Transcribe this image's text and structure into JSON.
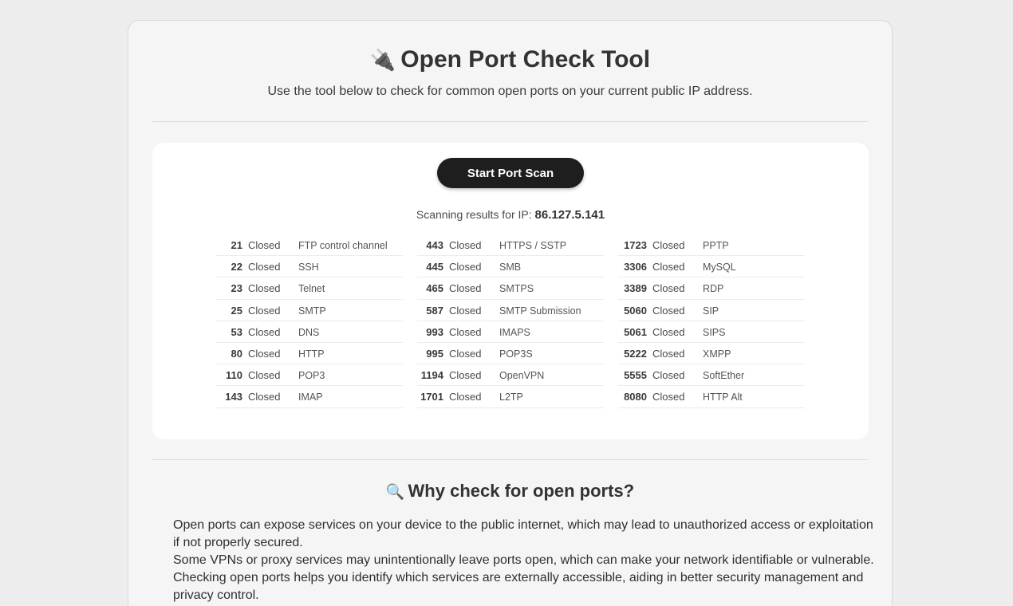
{
  "header": {
    "title_icon": "🔌",
    "title": "Open Port Check Tool",
    "subtitle": "Use the tool below to check for common open ports on your current public IP address."
  },
  "scan": {
    "button_label": "Start Port Scan",
    "results_label": "Scanning results for IP:",
    "ip": "86.127.5.141"
  },
  "ports": {
    "columns": [
      [
        {
          "port": "21",
          "status": "Closed",
          "service": "FTP control channel"
        },
        {
          "port": "22",
          "status": "Closed",
          "service": "SSH"
        },
        {
          "port": "23",
          "status": "Closed",
          "service": "Telnet"
        },
        {
          "port": "25",
          "status": "Closed",
          "service": "SMTP"
        },
        {
          "port": "53",
          "status": "Closed",
          "service": "DNS"
        },
        {
          "port": "80",
          "status": "Closed",
          "service": "HTTP"
        },
        {
          "port": "110",
          "status": "Closed",
          "service": "POP3"
        },
        {
          "port": "143",
          "status": "Closed",
          "service": "IMAP"
        }
      ],
      [
        {
          "port": "443",
          "status": "Closed",
          "service": "HTTPS / SSTP"
        },
        {
          "port": "445",
          "status": "Closed",
          "service": "SMB"
        },
        {
          "port": "465",
          "status": "Closed",
          "service": "SMTPS"
        },
        {
          "port": "587",
          "status": "Closed",
          "service": "SMTP Submission"
        },
        {
          "port": "993",
          "status": "Closed",
          "service": "IMAPS"
        },
        {
          "port": "995",
          "status": "Closed",
          "service": "POP3S"
        },
        {
          "port": "1194",
          "status": "Closed",
          "service": "OpenVPN"
        },
        {
          "port": "1701",
          "status": "Closed",
          "service": "L2TP"
        }
      ],
      [
        {
          "port": "1723",
          "status": "Closed",
          "service": "PPTP"
        },
        {
          "port": "3306",
          "status": "Closed",
          "service": "MySQL"
        },
        {
          "port": "3389",
          "status": "Closed",
          "service": "RDP"
        },
        {
          "port": "5060",
          "status": "Closed",
          "service": "SIP"
        },
        {
          "port": "5061",
          "status": "Closed",
          "service": "SIPS"
        },
        {
          "port": "5222",
          "status": "Closed",
          "service": "XMPP"
        },
        {
          "port": "5555",
          "status": "Closed",
          "service": "SoftEther"
        },
        {
          "port": "8080",
          "status": "Closed",
          "service": "HTTP Alt"
        }
      ]
    ]
  },
  "why": {
    "icon": "🔍",
    "title": "Why check for open ports?",
    "paragraphs": [
      "Open ports can expose services on your device to the public internet, which may lead to unauthorized access or exploitation if not properly secured.",
      "Some VPNs or proxy services may unintentionally leave ports open, which can make your network identifiable or vulnerable.",
      "Checking open ports helps you identify which services are externally accessible, aiding in better security management and privacy control."
    ]
  }
}
